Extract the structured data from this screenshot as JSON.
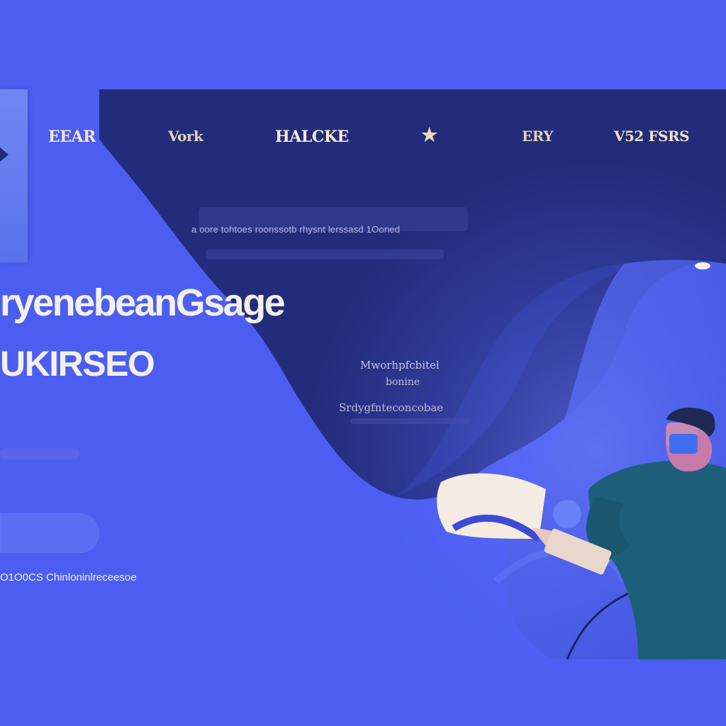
{
  "nav": {
    "brand": "EEAR",
    "items": [
      "Vork",
      "HALCKE",
      "ERY",
      "V52 FSRS"
    ],
    "star_icon": "star-icon"
  },
  "search": {
    "text": "a oore  tohtoes  roonssotb rhysnt  lerssasd  1Ooned"
  },
  "hero": {
    "headline": "ryenebeanGsage",
    "subheadline": "UKIRSEO"
  },
  "info": {
    "line1": "Mworhpfcbitel",
    "line2": "bonine",
    "line3": "Srdygfnteconcobae"
  },
  "footer": {
    "text": "O1O0CS Chinloninlreceesoe"
  },
  "colors": {
    "background": "#4b5ef1",
    "dark_panel": "#242d7a",
    "nav_text": "#f1e6c6",
    "headline_text": "#f3f0ea",
    "figure_shirt": "#1d5f7a",
    "figure_face": "#c77aa8",
    "figure_mask": "#3f6ff0"
  },
  "illustration": {
    "subject": "person-wearing-vr-headset-icon"
  }
}
